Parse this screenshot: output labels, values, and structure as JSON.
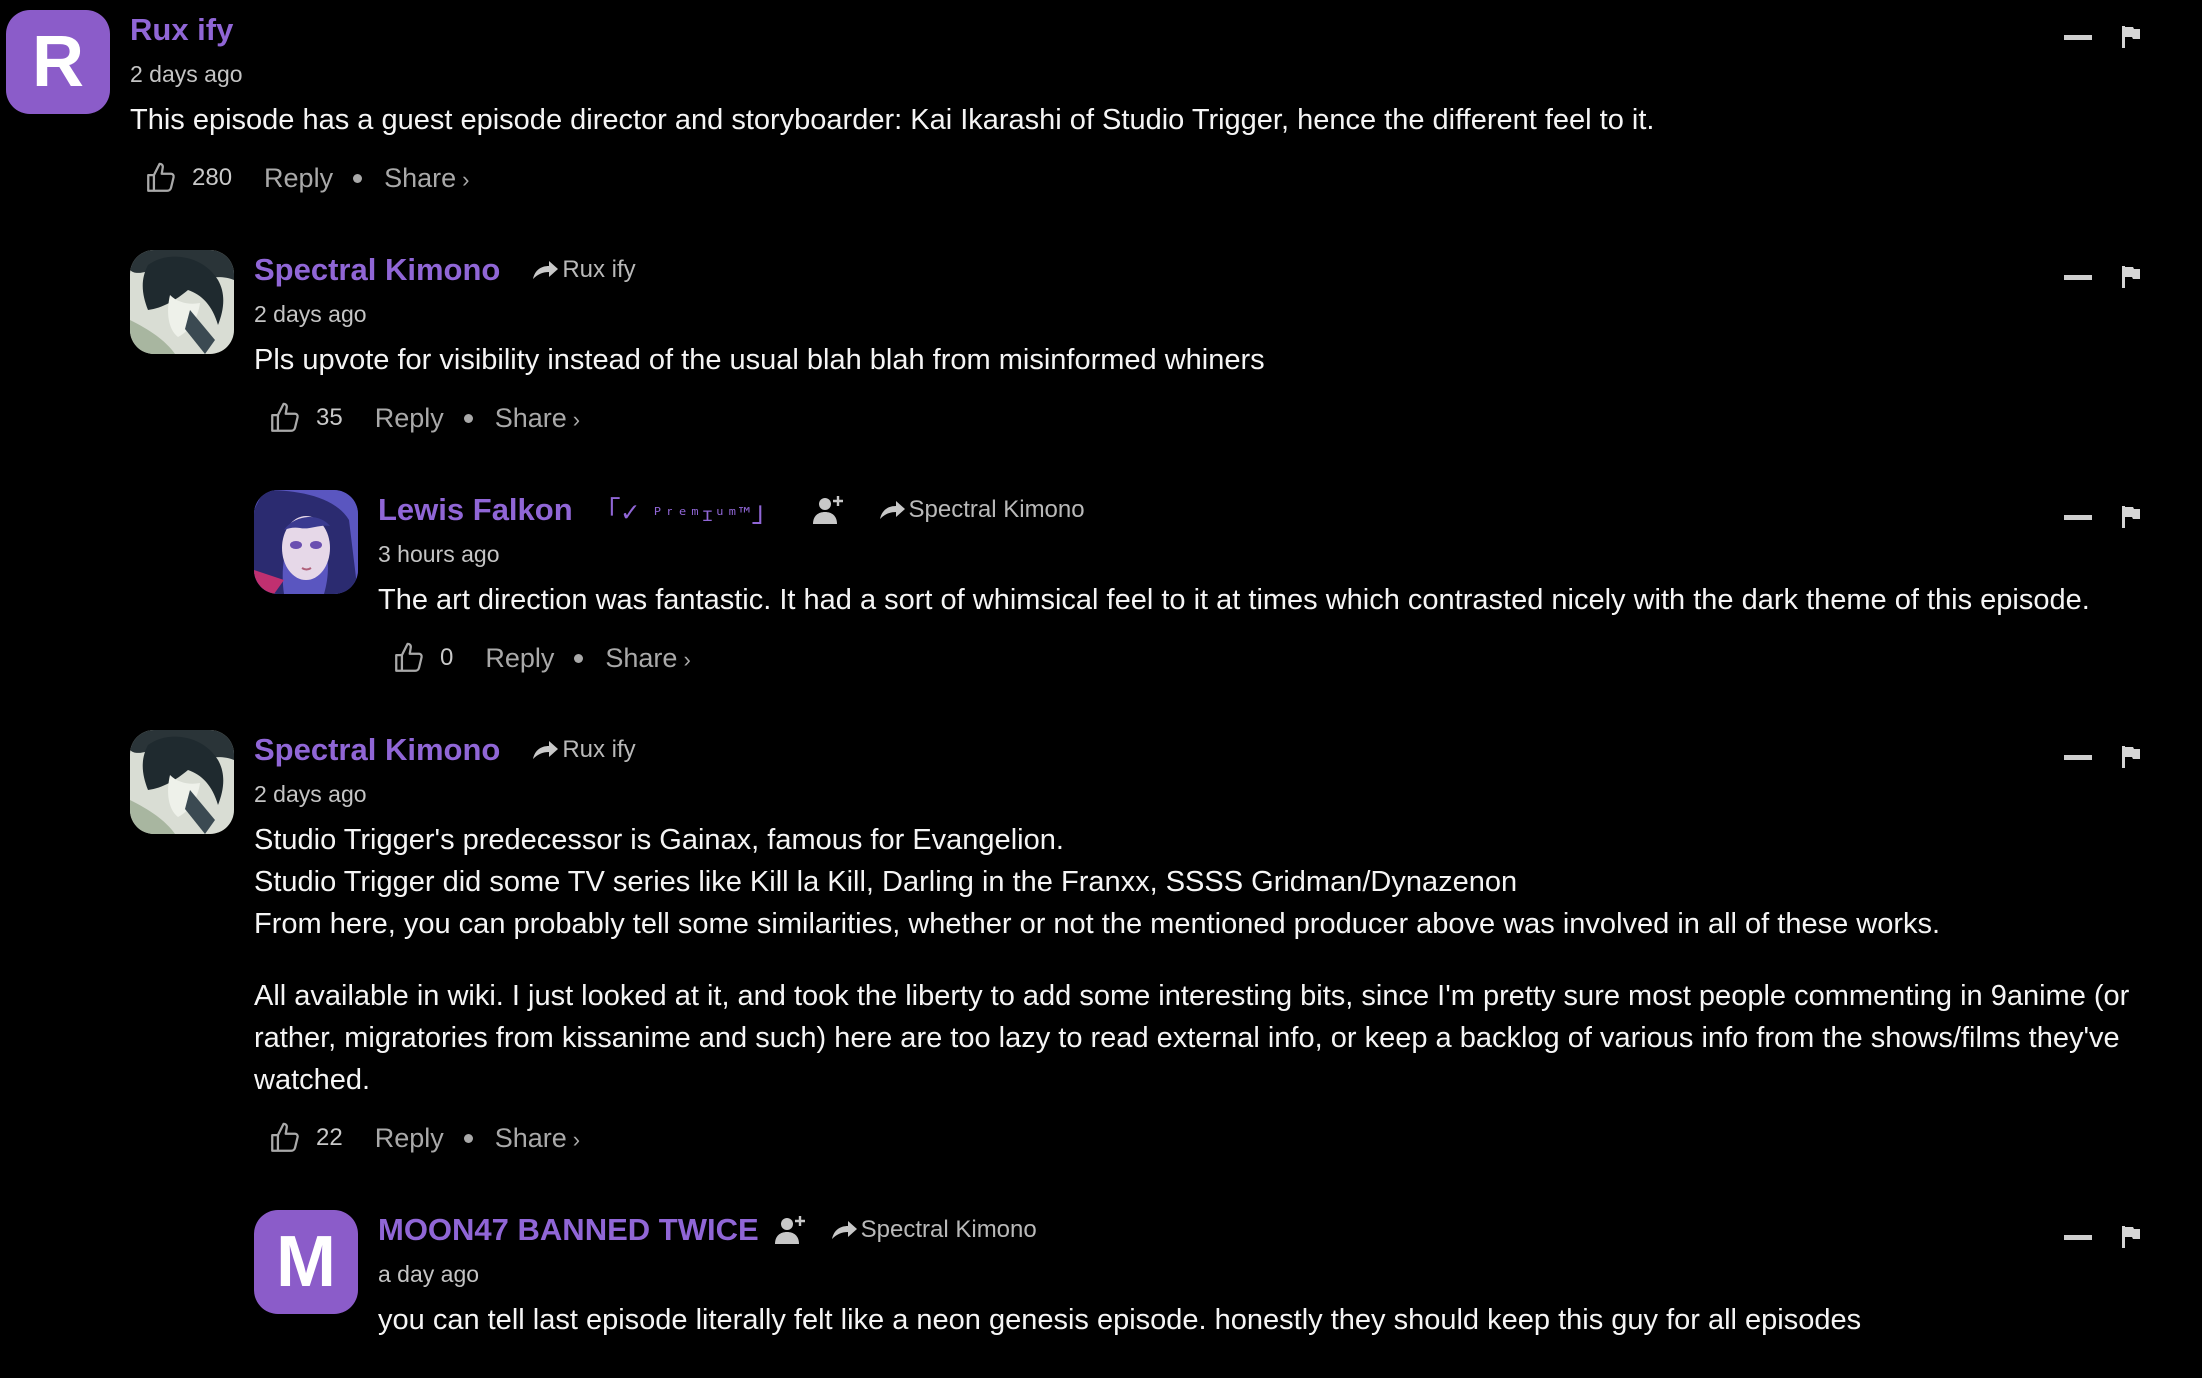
{
  "comments": [
    {
      "username": "Rux ify",
      "avatar_letter": "R",
      "time": "2 days ago",
      "paragraphs": [
        "This episode has a guest episode director and storyboarder: Kai Ikarashi of Studio Trigger, hence the different feel to it."
      ],
      "likes": "280",
      "reply_label": "Reply",
      "share_label": "Share",
      "share_chevron": "›"
    },
    {
      "username": "Spectral Kimono",
      "reply_to": "Rux ify",
      "time": "2 days ago",
      "paragraphs": [
        "Pls upvote for visibility instead of the usual blah blah from misinformed whiners"
      ],
      "likes": "35",
      "reply_label": "Reply",
      "share_label": "Share",
      "share_chevron": "›"
    },
    {
      "username": "Lewis Falkon",
      "badge": "ᴾʳᵉᵐɪᵘᵐ™",
      "badge_open": "「✓",
      "badge_close": "」",
      "reply_to": "Spectral Kimono",
      "time": "3 hours ago",
      "paragraphs": [
        "The art direction was fantastic. It had a sort of whimsical feel to it at times which contrasted nicely with the dark theme of this episode."
      ],
      "likes": "0",
      "reply_label": "Reply",
      "share_label": "Share",
      "share_chevron": "›"
    },
    {
      "username": "Spectral Kimono",
      "reply_to": "Rux ify",
      "time": "2 days ago",
      "paragraphs": [
        "Studio Trigger's predecessor is Gainax, famous for Evangelion.",
        "Studio Trigger did some TV series like Kill la Kill, Darling in the Franxx, SSSS Gridman/Dynazenon",
        "From here, you can probably tell some similarities, whether or not the mentioned producer above was involved in all of these works.",
        "All available in wiki. I just looked at it, and took the liberty to add some interesting bits, since I'm pretty sure most people commenting in 9anime (or rather, migratories from kissanime and such) here are too lazy to read external info, or keep a backlog of various info from the shows/films they've watched."
      ],
      "likes": "22",
      "reply_label": "Reply",
      "share_label": "Share",
      "share_chevron": "›"
    },
    {
      "username": "MOON47 BANNED TWICE",
      "avatar_letter": "M",
      "reply_to": "Spectral Kimono",
      "time": "a day ago",
      "paragraphs": [
        "you can tell last episode literally felt like a neon genesis episode. honestly they should keep this guy for all episodes"
      ]
    }
  ],
  "colors": {
    "background": "#000000",
    "username": "#9066d6",
    "avatar_letter_bg": "#8b5cc9",
    "meta_text": "#c4c4c4"
  },
  "icons": [
    "like-icon",
    "reply-arrow-icon",
    "add-user-icon",
    "minus-icon",
    "flag-icon"
  ]
}
